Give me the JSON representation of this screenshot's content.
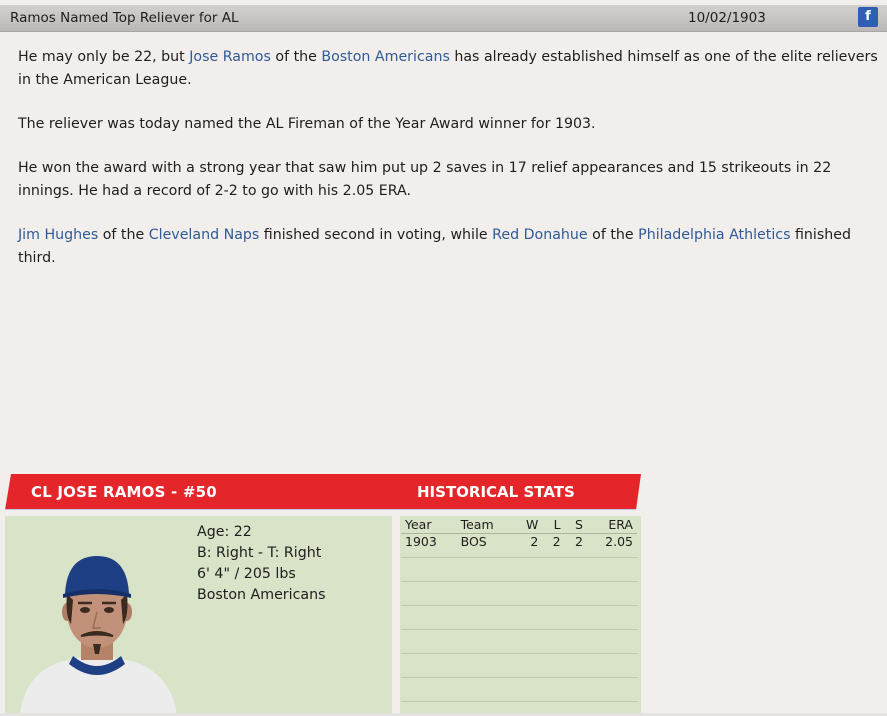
{
  "header": {
    "title": "Ramos Named Top Reliever for AL",
    "date": "10/02/1903",
    "share_icon": "f"
  },
  "article": {
    "p1_a": "He may only be 22, but ",
    "p1_player": "Jose Ramos",
    "p1_b": " of the ",
    "p1_team": "Boston Americans",
    "p1_c": " has already established himself as one of the elite relievers in the American League.",
    "p2": "The reliever was today named the AL Fireman of the Year Award winner for 1903.",
    "p3": "He won the award with a strong year that saw him put up 2 saves in 17 relief appearances and 15 strikeouts in 22 innings. He had a record of 2-2 to go with his 2.05 ERA.",
    "p4_player1": "Jim Hughes",
    "p4_a": " of the ",
    "p4_team1": "Cleveland Naps",
    "p4_b": " finished second in voting, while ",
    "p4_player2": "Red Donahue",
    "p4_c": " of the ",
    "p4_team2": "Philadelphia Athletics",
    "p4_d": " finished third."
  },
  "card": {
    "name": "CL JOSE RAMOS - #50",
    "hist_title": "HISTORICAL STATS",
    "age": "Age: 22",
    "bats_throws": "B: Right - T: Right",
    "height_weight": "6' 4\" / 205 lbs",
    "team": "Boston Americans",
    "colors": {
      "header_red": "#e4262b",
      "panel_green": "#d8e3c7"
    }
  },
  "stats": {
    "headers": [
      "Year",
      "Team",
      "W",
      "L",
      "S",
      "ERA"
    ],
    "rows": [
      [
        "1903",
        "BOS",
        "2",
        "2",
        "2",
        "2.05"
      ]
    ]
  }
}
